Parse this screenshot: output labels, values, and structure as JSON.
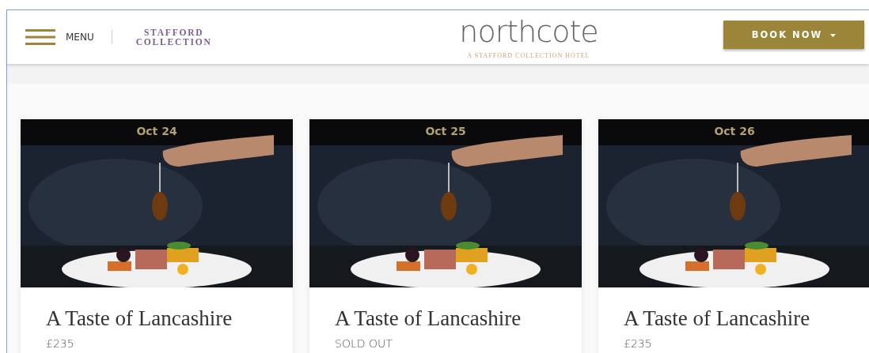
{
  "header": {
    "menu_label": "MENU",
    "partner_logo": [
      "STAFFORD",
      "COLLECTION"
    ],
    "logo": "northcote",
    "logo_tagline": "A STAFFORD COLLECTION HOTEL",
    "book_button": "BOOK NOW"
  },
  "events": [
    {
      "date": "Oct 24",
      "title": "A Taste of Lancashire",
      "price": "£235"
    },
    {
      "date": "Oct 25",
      "title": "A Taste of Lancashire",
      "price": "SOLD OUT"
    },
    {
      "date": "Oct 26",
      "title": "A Taste of Lancashire",
      "price": "£235"
    }
  ]
}
